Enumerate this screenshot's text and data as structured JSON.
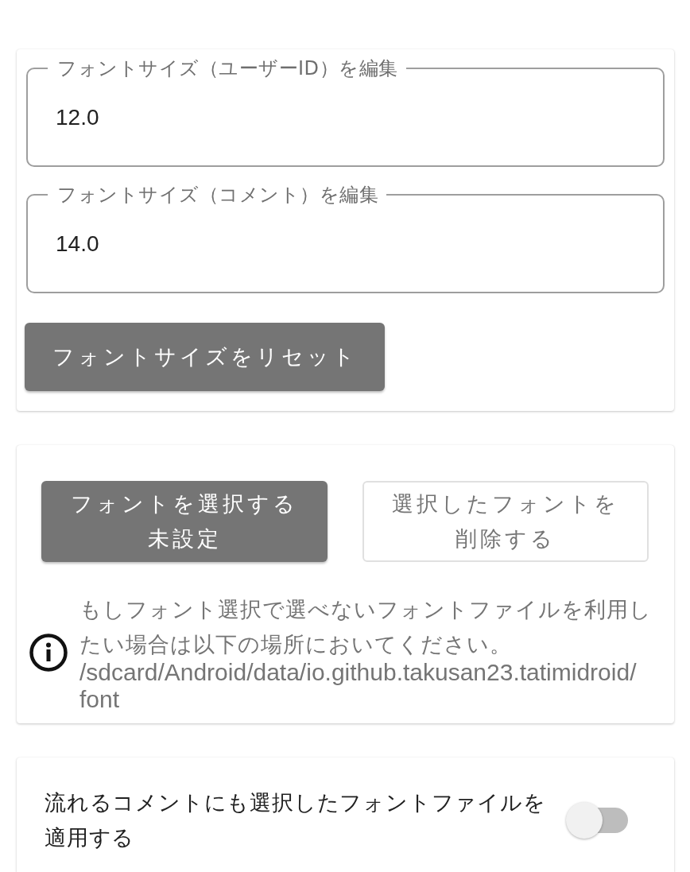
{
  "font_size_card": {
    "fields": [
      {
        "label": "フォントサイズ（ユーザーID）を編集",
        "value": "12.0"
      },
      {
        "label": "フォントサイズ（コメント）を編集",
        "value": "14.0"
      }
    ],
    "reset_button": "フォントサイズをリセット"
  },
  "font_file_card": {
    "select_button": {
      "label": "フォントを選択する",
      "current_font": "未設定"
    },
    "delete_button": "選択したフォントを削除する",
    "info": {
      "message": "もしフォント選択で選べないフォントファイルを利用したい場合は以下の場所においてください。",
      "path": "/sdcard/Android/data/io.github.takusan23.tatimidroid/font"
    }
  },
  "comment_font_card": {
    "label": "流れるコメントにも選択したフォントファイルを適用する",
    "on": false
  }
}
